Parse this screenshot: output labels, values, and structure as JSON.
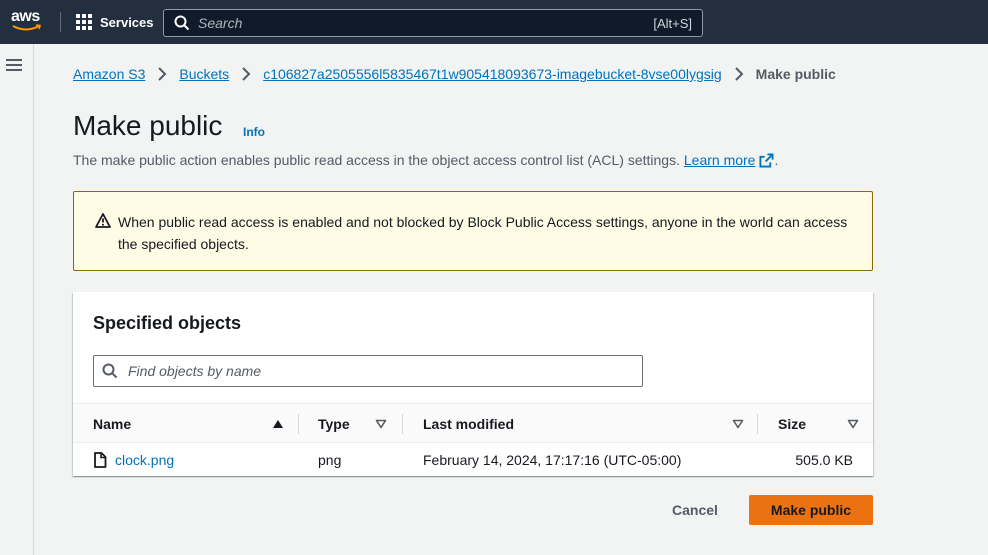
{
  "topnav": {
    "logo_text": "aws",
    "services_label": "Services",
    "search_placeholder": "Search",
    "search_shortcut": "[Alt+S]"
  },
  "breadcrumb": {
    "items": [
      "Amazon S3",
      "Buckets",
      "c106827a2505556l5835467t1w905418093673-imagebucket-8vse00lygsig"
    ],
    "current": "Make public"
  },
  "header": {
    "title": "Make public",
    "info_label": "Info",
    "description": "The make public action enables public read access in the object access control list (ACL) settings.",
    "learn_more": "Learn more",
    "description_end": "."
  },
  "warning": {
    "text": "When public read access is enabled and not blocked by Block Public Access settings, anyone in the world can access the specified objects."
  },
  "objects": {
    "title": "Specified objects",
    "find_placeholder": "Find objects by name",
    "columns": [
      "Name",
      "Type",
      "Last modified",
      "Size"
    ],
    "rows": [
      {
        "name": "clock.png",
        "type": "png",
        "last_modified": "February 14, 2024, 17:17:16 (UTC-05:00)",
        "size": "505.0 KB"
      }
    ]
  },
  "footer": {
    "cancel_label": "Cancel",
    "submit_label": "Make public"
  },
  "colors": {
    "nav_bg": "#232f3e",
    "link": "#0073bb",
    "primary": "#ec7211",
    "warning_bg": "#fffce6",
    "warning_border": "#8c6a00"
  }
}
